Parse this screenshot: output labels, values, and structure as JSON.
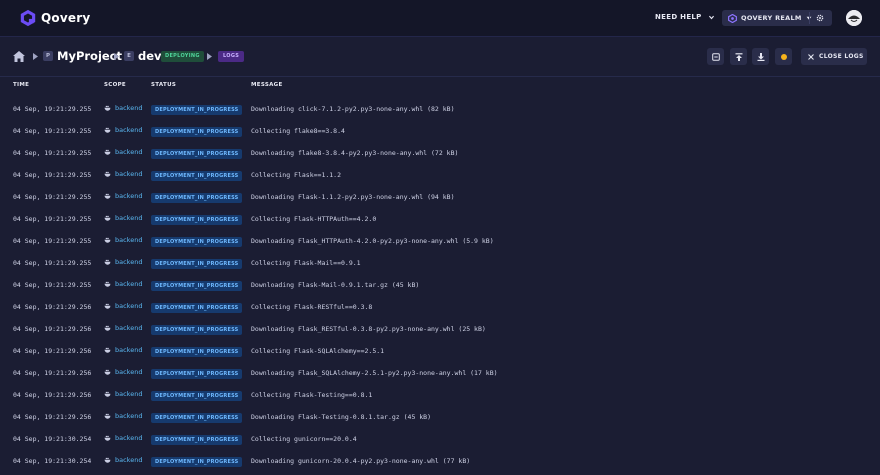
{
  "app": {
    "name": "Qovery"
  },
  "header": {
    "need_help": "NEED HELP",
    "realm": "QOVERY REALM"
  },
  "breadcrumb": {
    "project_tag": "P",
    "project": "MyProject",
    "env_tag": "E",
    "env": "dev",
    "status": "DEPLOYING",
    "section": "LOGS"
  },
  "toolbar": {
    "close_logs": "CLOSE LOGS"
  },
  "columns": {
    "time": "TIME",
    "scope": "SCOPE",
    "status": "STATUS",
    "message": "MESSAGE"
  },
  "logs": [
    {
      "time": "04 Sep, 19:21:29.255",
      "scope": "backend",
      "status": "DEPLOYMENT_IN_PROGRESS",
      "message": "Downloading click-7.1.2-py2.py3-none-any.whl (82 kB)"
    },
    {
      "time": "04 Sep, 19:21:29.255",
      "scope": "backend",
      "status": "DEPLOYMENT_IN_PROGRESS",
      "message": "Collecting flake8==3.8.4"
    },
    {
      "time": "04 Sep, 19:21:29.255",
      "scope": "backend",
      "status": "DEPLOYMENT_IN_PROGRESS",
      "message": "Downloading flake8-3.8.4-py2.py3-none-any.whl (72 kB)"
    },
    {
      "time": "04 Sep, 19:21:29.255",
      "scope": "backend",
      "status": "DEPLOYMENT_IN_PROGRESS",
      "message": "Collecting Flask==1.1.2"
    },
    {
      "time": "04 Sep, 19:21:29.255",
      "scope": "backend",
      "status": "DEPLOYMENT_IN_PROGRESS",
      "message": "Downloading Flask-1.1.2-py2.py3-none-any.whl (94 kB)"
    },
    {
      "time": "04 Sep, 19:21:29.255",
      "scope": "backend",
      "status": "DEPLOYMENT_IN_PROGRESS",
      "message": "Collecting Flask-HTTPAuth==4.2.0"
    },
    {
      "time": "04 Sep, 19:21:29.255",
      "scope": "backend",
      "status": "DEPLOYMENT_IN_PROGRESS",
      "message": "Downloading Flask_HTTPAuth-4.2.0-py2.py3-none-any.whl (5.9 kB)"
    },
    {
      "time": "04 Sep, 19:21:29.255",
      "scope": "backend",
      "status": "DEPLOYMENT_IN_PROGRESS",
      "message": "Collecting Flask-Mail==0.9.1"
    },
    {
      "time": "04 Sep, 19:21:29.255",
      "scope": "backend",
      "status": "DEPLOYMENT_IN_PROGRESS",
      "message": "Downloading Flask-Mail-0.9.1.tar.gz (45 kB)"
    },
    {
      "time": "04 Sep, 19:21:29.256",
      "scope": "backend",
      "status": "DEPLOYMENT_IN_PROGRESS",
      "message": "Collecting Flask-RESTful==0.3.8"
    },
    {
      "time": "04 Sep, 19:21:29.256",
      "scope": "backend",
      "status": "DEPLOYMENT_IN_PROGRESS",
      "message": "Downloading Flask_RESTful-0.3.8-py2.py3-none-any.whl (25 kB)"
    },
    {
      "time": "04 Sep, 19:21:29.256",
      "scope": "backend",
      "status": "DEPLOYMENT_IN_PROGRESS",
      "message": "Collecting Flask-SQLAlchemy==2.5.1"
    },
    {
      "time": "04 Sep, 19:21:29.256",
      "scope": "backend",
      "status": "DEPLOYMENT_IN_PROGRESS",
      "message": "Downloading Flask_SQLAlchemy-2.5.1-py2.py3-none-any.whl (17 kB)"
    },
    {
      "time": "04 Sep, 19:21:29.256",
      "scope": "backend",
      "status": "DEPLOYMENT_IN_PROGRESS",
      "message": "Collecting Flask-Testing==0.8.1"
    },
    {
      "time": "04 Sep, 19:21:29.256",
      "scope": "backend",
      "status": "DEPLOYMENT_IN_PROGRESS",
      "message": "Downloading Flask-Testing-0.8.1.tar.gz (45 kB)"
    },
    {
      "time": "04 Sep, 19:21:30.254",
      "scope": "backend",
      "status": "DEPLOYMENT_IN_PROGRESS",
      "message": "Collecting gunicorn==20.0.4"
    },
    {
      "time": "04 Sep, 19:21:30.254",
      "scope": "backend",
      "status": "DEPLOYMENT_IN_PROGRESS",
      "message": "Downloading gunicorn-20.0.4-py2.py3-none-any.whl (77 kB)"
    }
  ],
  "icons": {
    "logo": "qovery-logo-icon",
    "home": "home-icon",
    "scope": "docker-whale-icon",
    "realm": "realm-icon",
    "settings": "gear-icon",
    "close": "close-icon"
  },
  "colors": {
    "accent": "#6c4cf5",
    "status_deploying": "#4fd49a",
    "status_progress": "#6fb9ff",
    "scope_link": "#59b6f0"
  }
}
